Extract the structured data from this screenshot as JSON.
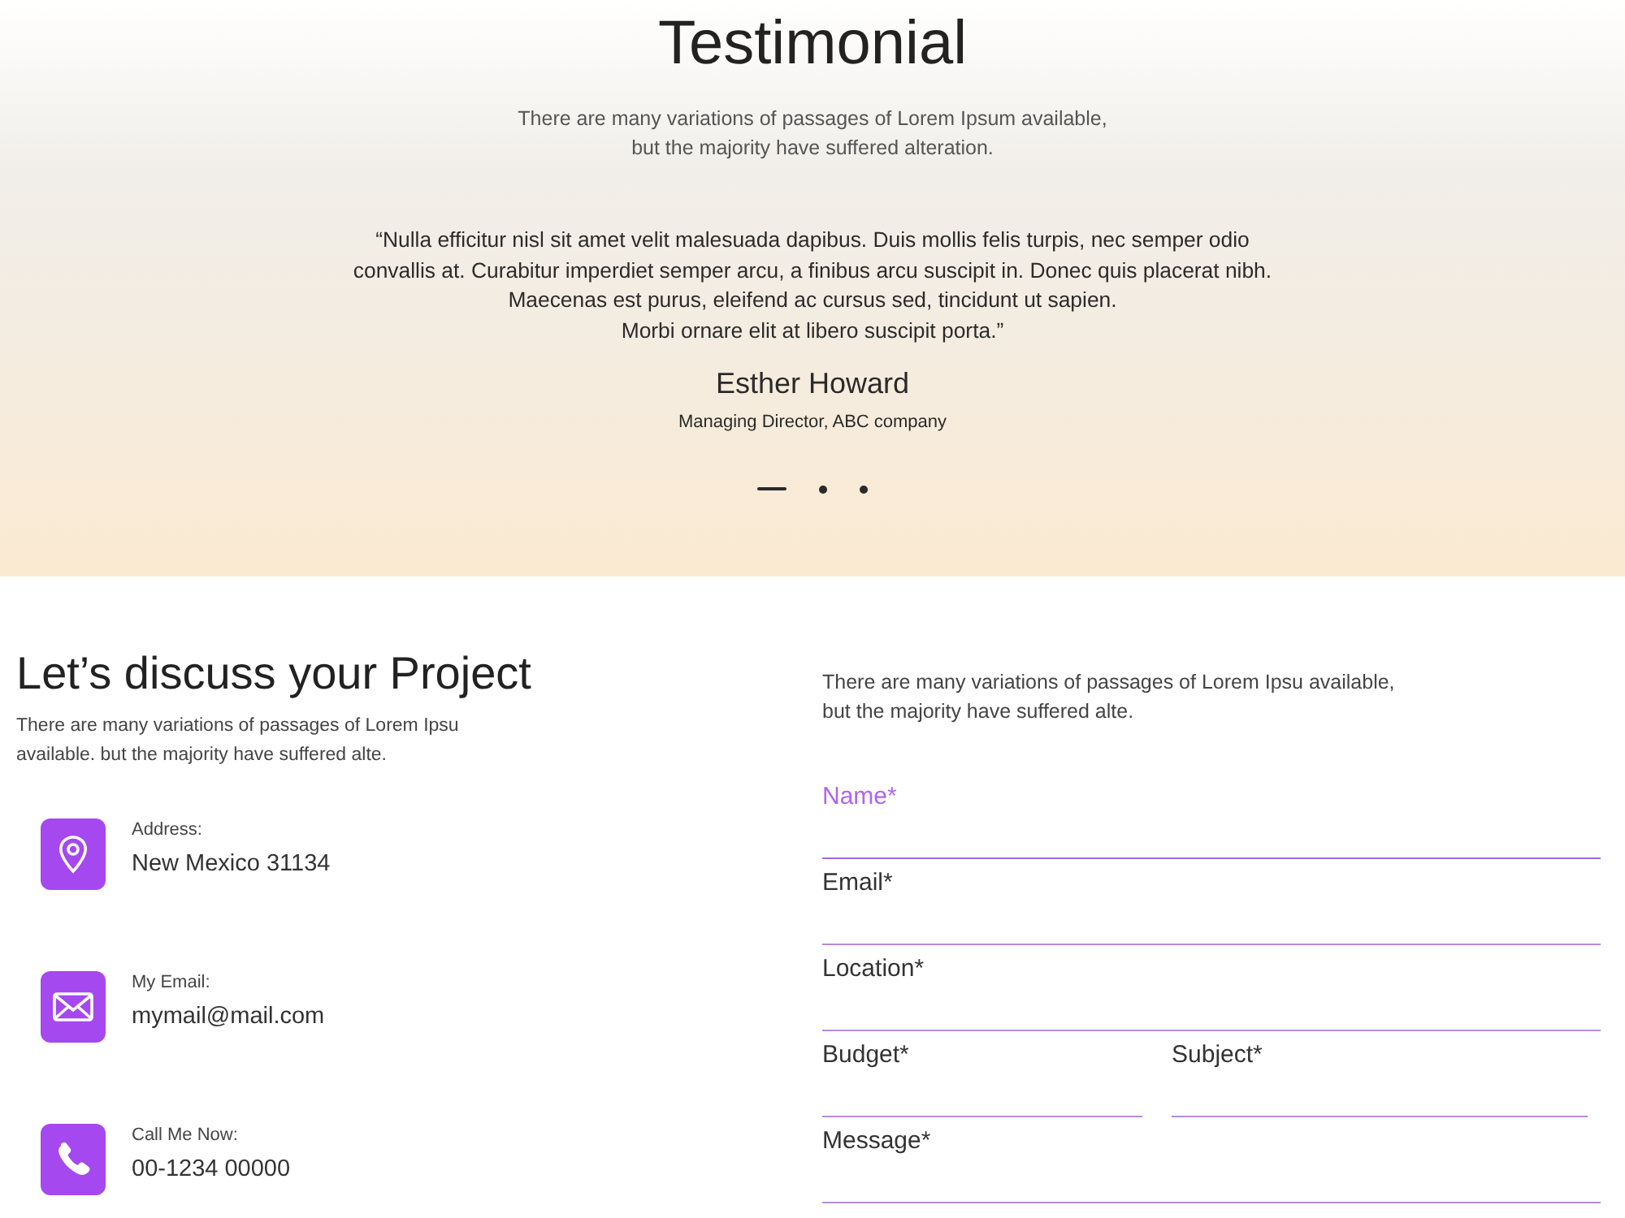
{
  "testimonial": {
    "title": "Testimonial",
    "subtitle": "There are many variations of passages of Lorem Ipsum available,\nbut the majority have suffered alteration.",
    "quote": "“Nulla efficitur nisl sit amet velit malesuada dapibus. Duis mollis felis turpis, nec semper odio\nconvallis at. Curabitur imperdiet semper arcu, a finibus arcu suscipit in. Donec quis placerat nibh.\nMaecenas est purus, eleifend ac cursus sed, tincidunt ut sapien.\nMorbi ornare elit at libero suscipit porta.”",
    "author": "Esther Howard",
    "role": "Managing Director, ABC company",
    "slides": [
      {
        "selected": true
      },
      {
        "selected": false
      },
      {
        "selected": false
      }
    ]
  },
  "contact": {
    "title": "Let’s discuss your Project",
    "intro": "There are many variations of passages of Lorem Ipsu\navailable. but the majority have suffered alte.",
    "info": [
      {
        "kind": "address",
        "label": "Address:",
        "value": "New Mexico 31134"
      },
      {
        "kind": "email",
        "label": "My Email:",
        "value": "mymail@mail.com"
      },
      {
        "kind": "phone",
        "label": "Call Me Now:",
        "value": "00-1234 00000"
      }
    ],
    "form": {
      "intro": "There are many variations of passages of Lorem Ipsu available,\nbut the majority have suffered alte.",
      "rows": [
        {
          "fields": [
            {
              "placeholder": "Name*",
              "focused": true
            }
          ]
        },
        {
          "fields": [
            {
              "placeholder": "Email*",
              "focused": false
            }
          ]
        },
        {
          "fields": [
            {
              "placeholder": "Location*",
              "focused": false
            }
          ]
        },
        {
          "fields": [
            {
              "placeholder": "Budget*",
              "focused": false
            },
            {
              "placeholder": "Subject*",
              "focused": false
            }
          ]
        },
        {
          "fields": [
            {
              "placeholder": "Message*",
              "focused": false
            }
          ]
        }
      ]
    }
  }
}
